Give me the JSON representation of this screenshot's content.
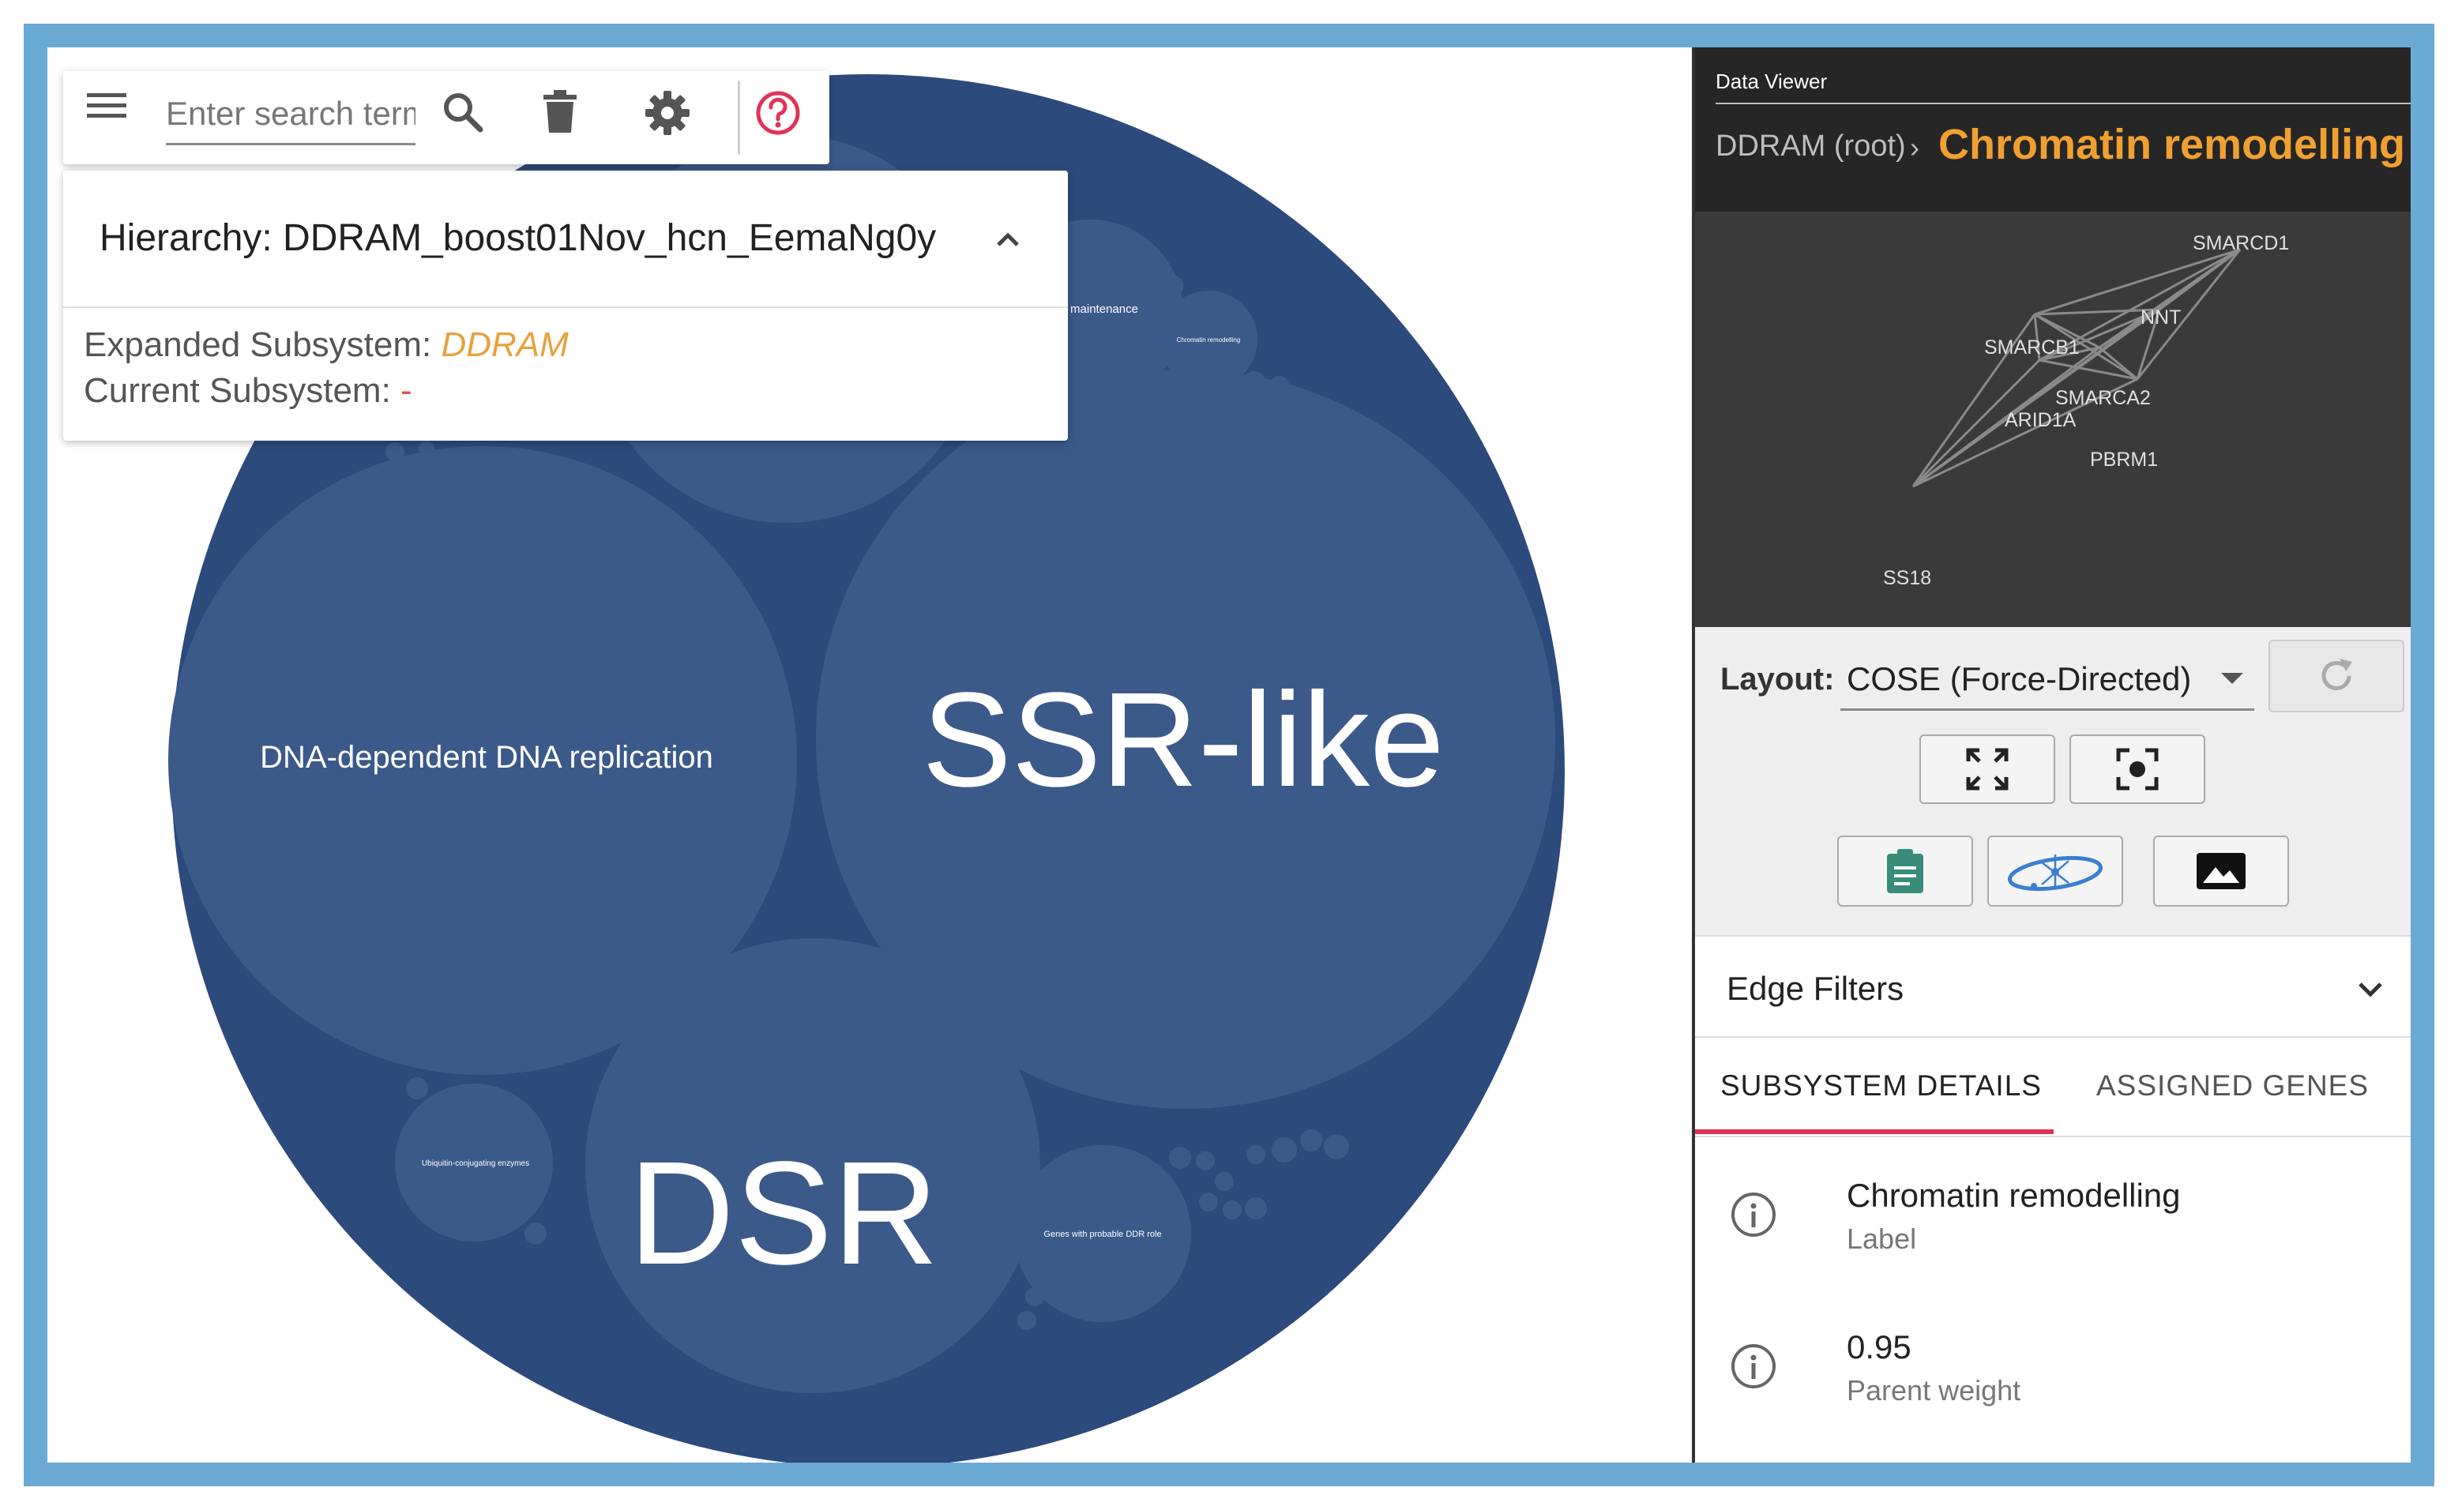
{
  "toolbar": {
    "menu_icon": "hamburger-menu-icon",
    "search_placeholder": "Enter search terms",
    "search_icon": "search-icon",
    "delete_icon": "trash-icon",
    "settings_icon": "gear-icon",
    "help_icon": "help-circle-icon",
    "help_color": "#e0335a"
  },
  "hierarchy": {
    "title": "Hierarchy: DDRAM_boost01Nov_hcn_EemaNg0y",
    "chevron_icon": "chevron-up-icon",
    "expanded_label": "Expanded Subsystem: ",
    "expanded_value": "DDRAM",
    "current_label": "Current Subsystem: ",
    "current_value": "-"
  },
  "bubbles": {
    "outer_color": "#2c4a7c",
    "inner_color": "#3b5a8a",
    "ssr_label": "SSR-like",
    "dsr_label": "DSR",
    "dna_replication_label": "DNA-dependent DNA replication",
    "ubiquitin_label": "Ubiquitin-conjugating enzymes",
    "probable_ddr_label": "Genes with probable DDR role",
    "maintenance_label": "maintenance",
    "chromatin_small_label": "Chromatin remodelling"
  },
  "data_viewer": {
    "title": "Data Viewer",
    "breadcrumb_root": "DDRAM (root)",
    "breadcrumb_separator": "›",
    "current": "Chromatin remodelling",
    "current_color": "#f0a030",
    "network_nodes": [
      "SMARCD1",
      "NNT",
      "SMARCB1",
      "SMARCA2",
      "ARID1A",
      "PBRM1",
      "SS18"
    ]
  },
  "controls": {
    "layout_label": "Layout:",
    "layout_value": "COSE (Force-Directed)",
    "refresh_icon": "refresh-icon",
    "fit_icon": "fit-screen-icon",
    "center_icon": "center-focus-icon",
    "clipboard_icon": "clipboard-icon",
    "orbit_icon": "orbit-network-icon",
    "image_icon": "image-icon"
  },
  "edge_filters": {
    "label": "Edge Filters",
    "chevron_icon": "chevron-down-icon"
  },
  "tabs": [
    {
      "label": "SUBSYSTEM DETAILS",
      "active": true
    },
    {
      "label": "ASSIGNED GENES",
      "active": false
    }
  ],
  "details": [
    {
      "icon": "info-icon",
      "value": "Chromatin remodelling",
      "caption": "Label"
    },
    {
      "icon": "info-icon",
      "value": "0.95",
      "caption": "Parent weight"
    }
  ]
}
